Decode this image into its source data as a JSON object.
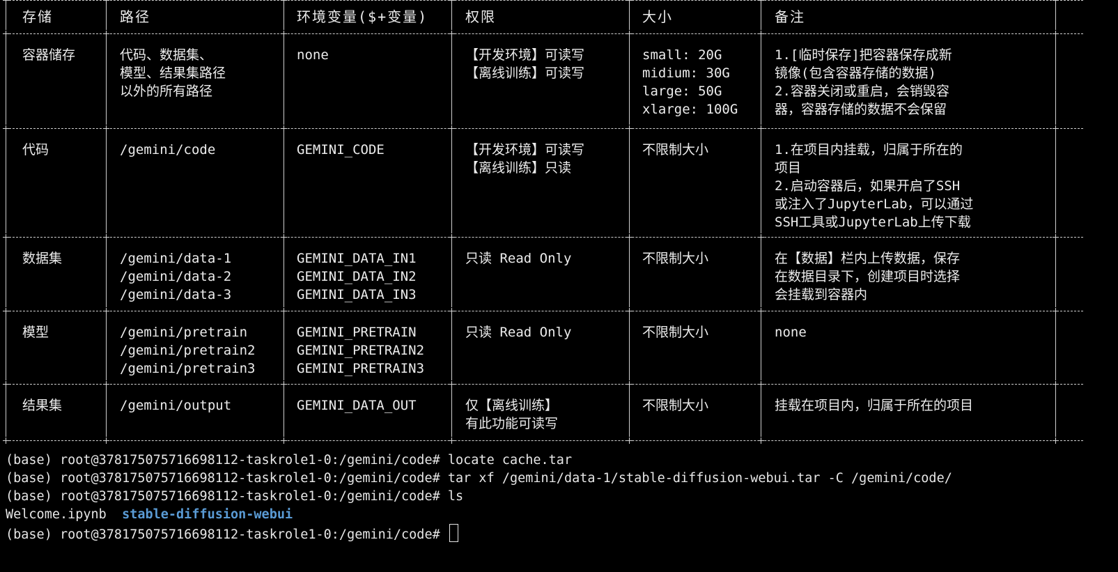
{
  "table": {
    "headers": [
      "存储",
      "路径",
      "环境变量($+变量)",
      "权限",
      "大小",
      "备注"
    ],
    "rows": [
      {
        "storage": [
          "容器储存"
        ],
        "path": [
          "代码、数据集、",
          "模型、结果集路径",
          "以外的所有路径"
        ],
        "env": [
          "none"
        ],
        "perm": [
          "【开发环境】可读写",
          "【离线训练】可读写"
        ],
        "size": [
          "small: 20G",
          "midium: 30G",
          "large: 50G",
          "xlarge: 100G"
        ],
        "note": [
          "1.[临时保存]把容器保存成新",
          "镜像(包含容器存储的数据)",
          "2.容器关闭或重启，会销毁容",
          "器，容器存储的数据不会保留"
        ]
      },
      {
        "storage": [
          "代码"
        ],
        "path": [
          "/gemini/code"
        ],
        "env": [
          "GEMINI_CODE"
        ],
        "perm": [
          "【开发环境】可读写",
          "【离线训练】只读"
        ],
        "size": [
          "不限制大小"
        ],
        "note": [
          "1.在项目内挂载，归属于所在的",
          "项目",
          "2.启动容器后，如果开启了SSH",
          "或注入了JupyterLab，可以通过",
          "SSH工具或JupyterLab上传下载"
        ]
      },
      {
        "storage": [
          "数据集"
        ],
        "path": [
          "/gemini/data-1",
          "/gemini/data-2",
          "/gemini/data-3"
        ],
        "env": [
          "GEMINI_DATA_IN1",
          "GEMINI_DATA_IN2",
          "GEMINI_DATA_IN3"
        ],
        "perm": [
          "只读 Read Only"
        ],
        "size": [
          "不限制大小"
        ],
        "note": [
          "在【数据】栏内上传数据，保存",
          "在数据目录下，创建项目时选择",
          "会挂载到容器内"
        ]
      },
      {
        "storage": [
          "模型"
        ],
        "path": [
          "/gemini/pretrain",
          "/gemini/pretrain2",
          "/gemini/pretrain3"
        ],
        "env": [
          "GEMINI_PRETRAIN",
          "GEMINI_PRETRAIN2",
          "GEMINI_PRETRAIN3"
        ],
        "perm": [
          "只读 Read Only"
        ],
        "size": [
          "不限制大小"
        ],
        "note": [
          "none"
        ]
      },
      {
        "storage": [
          "结果集"
        ],
        "path": [
          "/gemini/output"
        ],
        "env": [
          "GEMINI_DATA_OUT"
        ],
        "perm": [
          "仅【离线训练】",
          "有此功能可读写"
        ],
        "size": [
          "不限制大小"
        ],
        "note": [
          "挂载在项目内，归属于所在的项目"
        ]
      }
    ]
  },
  "terminal": {
    "prompt": "(base) root@378175075716698112-taskrole1-0:/gemini/code# ",
    "commands": [
      "locate cache.tar",
      "tar xf /gemini/data-1/stable-diffusion-webui.tar -C /gemini/code/",
      "ls"
    ],
    "ls_output": {
      "file": "Welcome.ipynb",
      "dir": "stable-diffusion-webui"
    },
    "current_input": ""
  },
  "colors": {
    "background": "#000000",
    "text": "#e6e6e6",
    "directory": "#5a9bd5"
  }
}
